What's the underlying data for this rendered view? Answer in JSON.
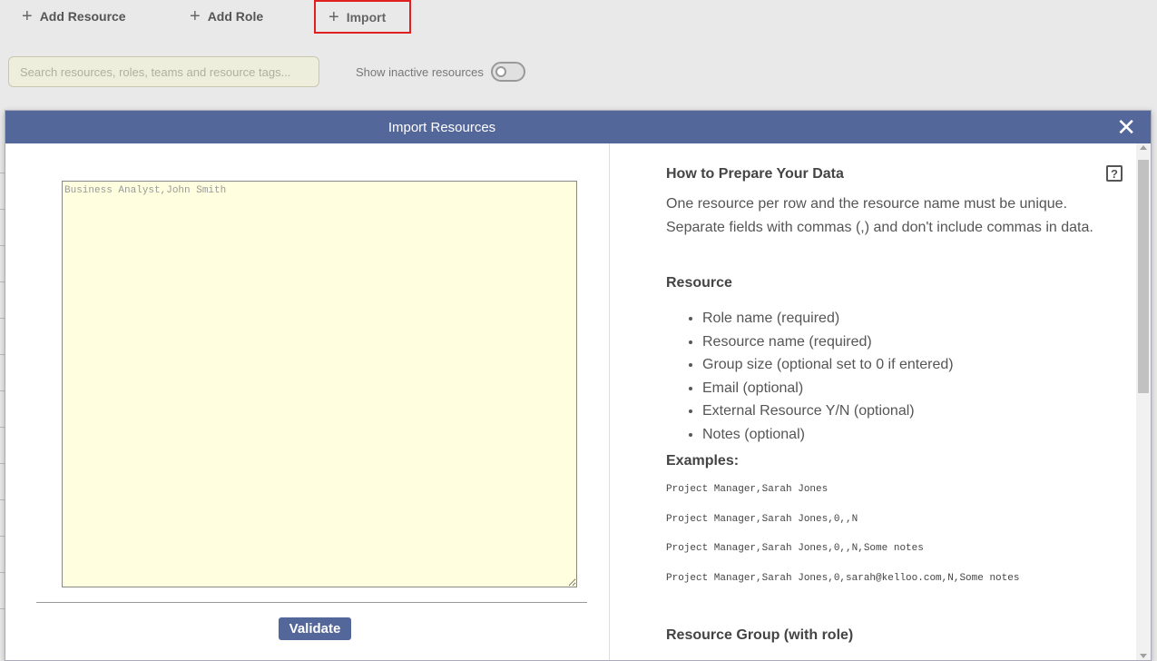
{
  "toolbar": {
    "add_resource": "Add Resource",
    "add_role": "Add Role",
    "import": "Import"
  },
  "search": {
    "placeholder": "Search resources, roles, teams and resource tags..."
  },
  "filters": {
    "show_inactive_label": "Show inactive resources",
    "show_inactive_on": false
  },
  "modal": {
    "title": "Import Resources",
    "textarea_placeholder": "Business Analyst,John Smith",
    "validate_label": "Validate",
    "help": {
      "heading": "How to Prepare Your Data",
      "line1": "One resource per row and the resource name must be unique.",
      "line2": "Separate fields with commas (,) and don't include commas in data.",
      "resource_heading": "Resource",
      "fields": [
        "Role name (required)",
        "Resource name (required)",
        "Group size (optional set to 0 if entered)",
        "Email (optional)",
        "External Resource Y/N (optional)",
        "Notes (optional)"
      ],
      "examples_heading": "Examples:",
      "examples": [
        "Project Manager,Sarah Jones",
        "Project Manager,Sarah Jones,0,,N",
        "Project Manager,Sarah Jones,0,,N,Some notes",
        "Project Manager,Sarah Jones,0,sarah@kelloo.com,N,Some notes"
      ],
      "group_heading": "Resource Group (with role)"
    }
  },
  "colors": {
    "header": "#54679a",
    "highlight_border": "#e02020",
    "textarea_bg": "#ffffdf"
  },
  "icons": {
    "plus": "plus-icon",
    "close": "close-icon",
    "help": "help-icon"
  }
}
